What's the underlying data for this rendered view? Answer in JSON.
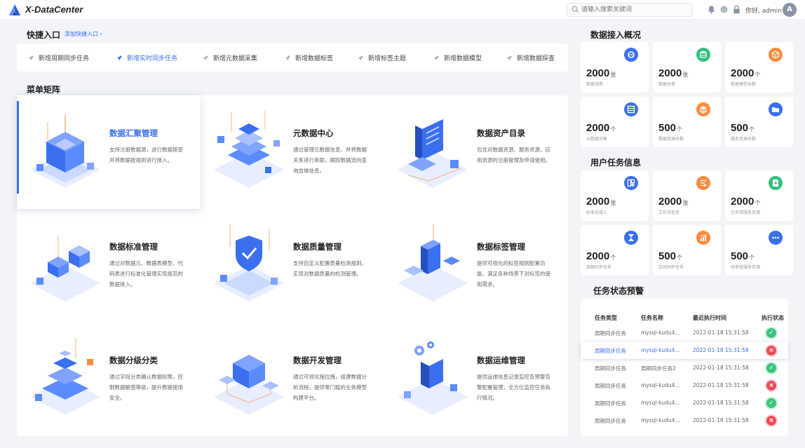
{
  "app": {
    "title": "X-DataCenter"
  },
  "header": {
    "search_placeholder": "请输入搜索关键词",
    "greeting": "你好, admin",
    "avatar_letter": "A",
    "icons": [
      "bell-icon",
      "gear-icon",
      "lock-icon"
    ]
  },
  "quick": {
    "title": "快捷入口",
    "add_link": "添加快捷入口 ›",
    "items": [
      {
        "label": "新增周期同步任务",
        "active": false
      },
      {
        "label": "新增实时同步任务",
        "active": true
      },
      {
        "label": "新增元数据采集",
        "active": false
      },
      {
        "label": "新增数据标签",
        "active": false
      },
      {
        "label": "新增标签主题",
        "active": false
      },
      {
        "label": "新增数据模型",
        "active": false
      },
      {
        "label": "新增数据探查",
        "active": false
      }
    ]
  },
  "matrix": {
    "title": "菜单矩阵",
    "cards": [
      {
        "title": "数据汇聚管理",
        "desc": "支持注册数据源，进行数据探查并将数据按规则进行接入。",
        "active": true
      },
      {
        "title": "元数据中心",
        "desc": "通过管理元数据信息，并将数据关系进行串联，跟踪数据流向查询血缘信息。",
        "active": false
      },
      {
        "title": "数据资产目录",
        "desc": "包含对数据资源、服务资源、应用资源的注册管理及申请使用。",
        "active": false
      },
      {
        "title": "数据标准管理",
        "desc": "通过对数据元、数据表模型、代码表进行标准化管理实现规范的数据接入。",
        "active": false
      },
      {
        "title": "数据质量管理",
        "desc": "支持自定义配置质量检测规则，实现对数据质量的检测管理。",
        "active": false
      },
      {
        "title": "数据标签管理",
        "desc": "提供可视化的标签规则配置功能，满足各种场景下对标签的使用需求。",
        "active": false
      },
      {
        "title": "数据分级分类",
        "desc": "通过字段分类确认数据权限，控制数据敏感等级，提升数据使用安全。",
        "active": false
      },
      {
        "title": "数据开发管理",
        "desc": "通过可视化拖拉拽，组建数据分析流程，提供零门槛的业务模型构建平台。",
        "active": false
      },
      {
        "title": "数据运维管理",
        "desc": "提供运维信息记录监控及预警告警配置管理，全方位监控任务执行情况。",
        "active": false
      }
    ]
  },
  "access": {
    "title": "数据接入概况",
    "stats": [
      {
        "num": "2000",
        "unit": "张",
        "label": "数据湖表",
        "color": "#3a6ff0",
        "icon": "lake-icon"
      },
      {
        "num": "2000",
        "unit": "张",
        "label": "数据仓表",
        "color": "#36c07e",
        "icon": "database-icon"
      },
      {
        "num": "2000",
        "unit": "个",
        "label": "数据模型总数",
        "color": "#ff8a3d",
        "icon": "cube-icon"
      },
      {
        "num": "2000",
        "unit": "个",
        "label": "元数据对象",
        "color": "#3a6ff0",
        "icon": "table-icon"
      },
      {
        "num": "500",
        "unit": "个",
        "label": "数据资源总数",
        "color": "#ff8a3d",
        "icon": "layers-icon"
      },
      {
        "num": "500",
        "unit": "个",
        "label": "服务资源总数",
        "color": "#3a6ff0",
        "icon": "folder-icon"
      }
    ]
  },
  "user_tasks": {
    "title": "用户任务信息",
    "stats": [
      {
        "num": "2000",
        "unit": "张",
        "label": "标准化接入",
        "color": "#3a6ff0",
        "icon": "standard-icon"
      },
      {
        "num": "2000",
        "unit": "张",
        "label": "工作流任务",
        "color": "#ff8a3d",
        "icon": "workflow-icon"
      },
      {
        "num": "2000",
        "unit": "个",
        "label": "已申请服务资源",
        "color": "#36c07e",
        "icon": "document-icon"
      },
      {
        "num": "2000",
        "unit": "个",
        "label": "周期同步任务",
        "color": "#3a6ff0",
        "icon": "hourglass-icon"
      },
      {
        "num": "500",
        "unit": "个",
        "label": "实时同步任务",
        "color": "#ff8a3d",
        "icon": "chart-icon"
      },
      {
        "num": "500",
        "unit": "个",
        "label": "待审批服务资源",
        "color": "#3a6ff0",
        "icon": "more-icon"
      }
    ]
  },
  "alerts": {
    "title": "任务状态预警",
    "headers": [
      "任务类型",
      "任务名称",
      "最近执行时间",
      "执行状态"
    ],
    "rows": [
      {
        "type": "周期同步任务",
        "name": "mysql-kudu4...",
        "time": "2022-01-18 15:31:58",
        "status": "ok",
        "highlight": false
      },
      {
        "type": "周期同步任务",
        "name": "mysql-kudu4...",
        "time": "2022-01-18 15:31:58",
        "status": "err",
        "highlight": true
      },
      {
        "type": "周期同步任务",
        "name": "周期同步任务2",
        "time": "2022-01-18 15:31:58",
        "status": "ok",
        "highlight": false
      },
      {
        "type": "周期同步任务",
        "name": "mysql-kudu4...",
        "time": "2022-01-18 15:31:58",
        "status": "err",
        "highlight": false
      },
      {
        "type": "周期同步任务",
        "name": "mysql-kudu4...",
        "time": "2022-01-18 15:31:58",
        "status": "ok",
        "highlight": false
      },
      {
        "type": "周期同步任务",
        "name": "mysql-kudu4...",
        "time": "2022-01-18 15:31:58",
        "status": "err",
        "highlight": false
      }
    ]
  }
}
